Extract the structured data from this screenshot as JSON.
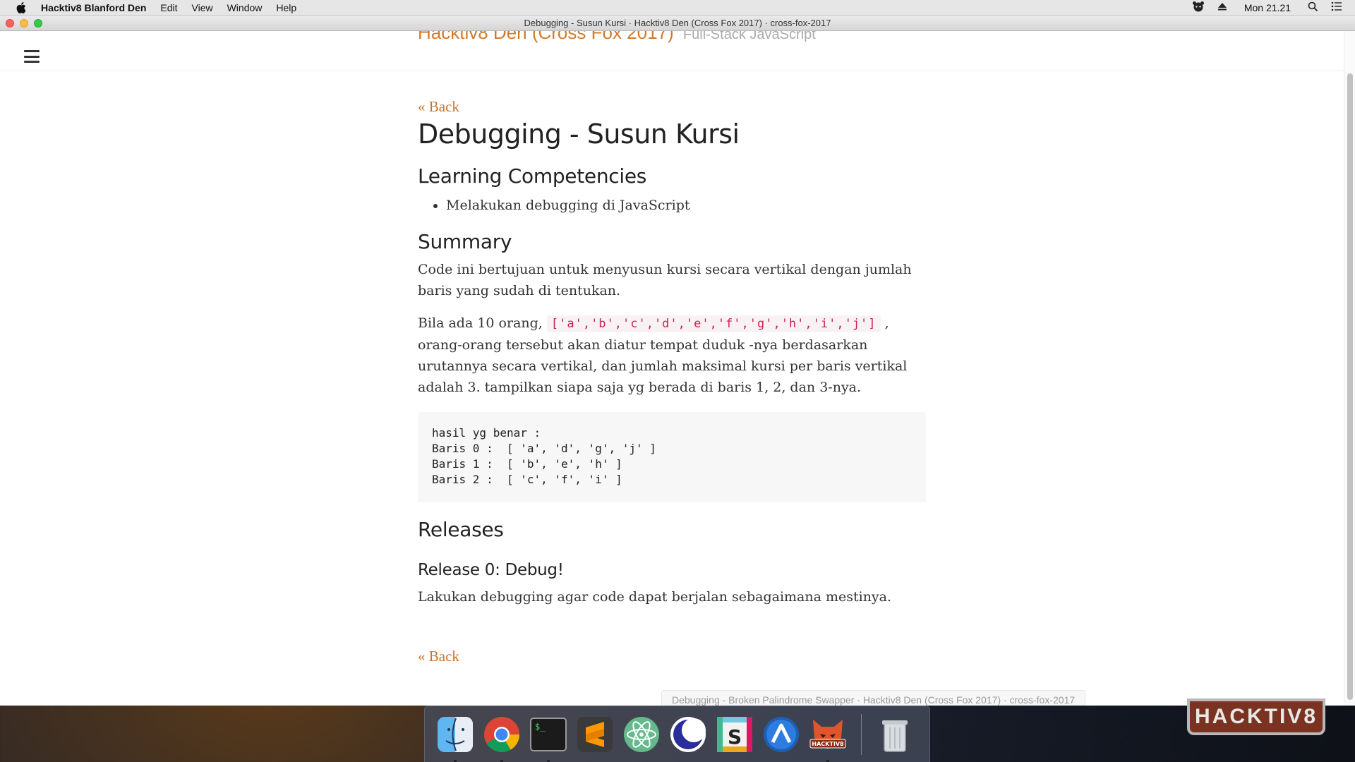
{
  "menubar": {
    "app_name": "Hacktiv8 Blanford Den",
    "items": [
      "Edit",
      "View",
      "Window",
      "Help"
    ],
    "clock": "Mon 21.21"
  },
  "window": {
    "title": "Debugging - Susun Kursi · Hacktiv8 Den (Cross Fox 2017) · cross-fox-2017"
  },
  "site": {
    "title": "Hacktiv8 Den (Cross Fox 2017)",
    "subtitle": "Full-Stack JavaScript"
  },
  "article": {
    "back_label": "« Back",
    "title": "Debugging - Susun Kursi",
    "competencies_heading": "Learning Competencies",
    "competencies": [
      "Melakukan debugging di JavaScript"
    ],
    "summary_heading": "Summary",
    "summary_p1": "Code ini bertujuan untuk menyusun kursi secara vertikal dengan jumlah baris yang sudah di tentukan.",
    "summary_p2_before": "Bila ada 10 orang, ",
    "summary_p2_code": "['a','b','c','d','e','f','g','h','i','j']",
    "summary_p2_after": " , orang-orang tersebut akan diatur tempat duduk -nya berdasarkan urutannya secara vertikal, dan jumlah maksimal kursi per baris vertikal adalah 3. tampilkan siapa saja yg berada di baris 1, 2, dan 3-nya.",
    "code_block": "hasil yg benar :\nBaris 0 :  [ 'a', 'd', 'g', 'j' ]\nBaris 1 :  [ 'b', 'e', 'h' ]\nBaris 2 :  [ 'c', 'f', 'i' ]",
    "releases_heading": "Releases",
    "release0_heading": "Release 0: Debug!",
    "release0_text": "Lakukan debugging agar code dapat berjalan sebagaimana mestinya."
  },
  "status_url": "Debugging - Broken Palindrome Swapper · Hacktiv8 Den (Cross Fox 2017) · cross-fox-2017",
  "dock": {
    "badge_text": "HACKTIV8",
    "hacktiv8_label": "HACKTIV8",
    "terminal_prompt": "$_",
    "sublime_letter": "S",
    "slack_letter": "S"
  },
  "colors": {
    "link": "#c8732a",
    "inline_code": "#c7254e",
    "code_bg": "#f7f7f7"
  }
}
